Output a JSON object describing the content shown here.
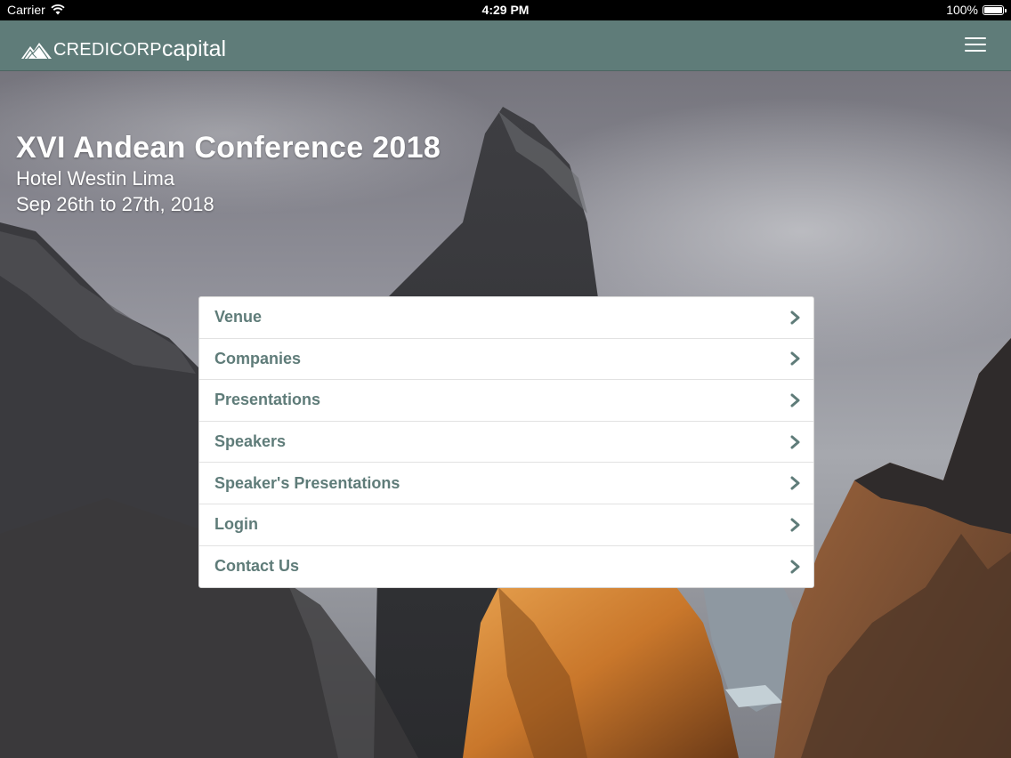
{
  "status_bar": {
    "carrier": "Carrier",
    "time": "4:29 PM",
    "battery": "100%"
  },
  "nav": {
    "logo_part1": "CREDICORP",
    "logo_part2": "capital",
    "menu_icon": "hamburger-icon"
  },
  "hero": {
    "title": "XVI Andean Conference 2018",
    "venue": "Hotel Westin Lima",
    "dates": "Sep 26th to 27th, 2018"
  },
  "menu": {
    "items": [
      {
        "label": "Venue"
      },
      {
        "label": "Companies"
      },
      {
        "label": "Presentations"
      },
      {
        "label": "Speakers"
      },
      {
        "label": "Speaker's Presentations"
      },
      {
        "label": "Login"
      },
      {
        "label": "Contact Us"
      }
    ]
  },
  "colors": {
    "nav_background": "#5f7c79",
    "menu_text": "#5f7c79"
  }
}
